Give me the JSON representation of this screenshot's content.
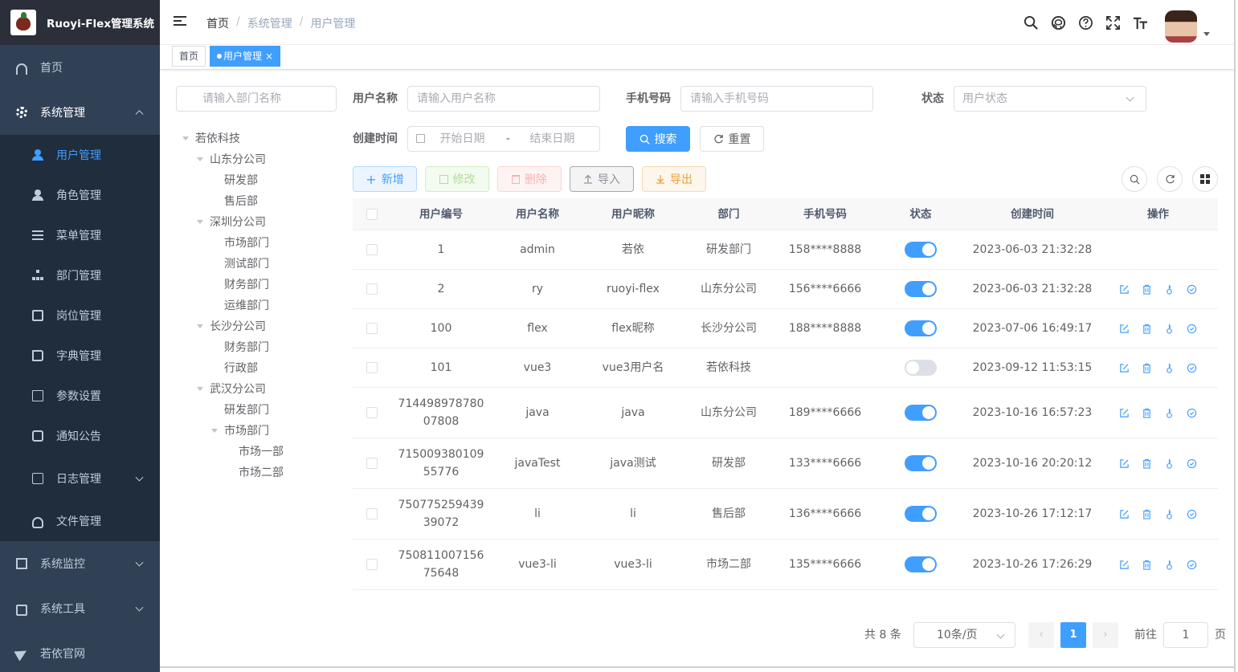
{
  "app": {
    "title": "Ruoyi-Flex管理系统"
  },
  "sidebar": {
    "home": "首页",
    "system": "系统管理",
    "sub": [
      "用户管理",
      "角色管理",
      "菜单管理",
      "部门管理",
      "岗位管理",
      "字典管理",
      "参数设置",
      "通知公告",
      "日志管理",
      "文件管理"
    ],
    "monitor": "系统监控",
    "tools": "系统工具",
    "site": "若依官网"
  },
  "breadcrumb": [
    "首页",
    "系统管理",
    "用户管理"
  ],
  "tags": {
    "home": "首页",
    "active": "用户管理"
  },
  "search": {
    "dept_placeholder": "请输入部门名称",
    "username_label": "用户名称",
    "username_placeholder": "请输入用户名称",
    "phone_label": "手机号码",
    "phone_placeholder": "请输入手机号码",
    "status_label": "状态",
    "status_placeholder": "用户状态",
    "created_label": "创建时间",
    "start_placeholder": "开始日期",
    "range_sep": "-",
    "end_placeholder": "结束日期",
    "search_btn": "搜索",
    "reset_btn": "重置"
  },
  "toolbar": {
    "add": "新增",
    "edit": "修改",
    "delete": "删除",
    "import": "导入",
    "export": "导出"
  },
  "tree": [
    {
      "label": "若依科技",
      "level": 0,
      "caret": true
    },
    {
      "label": "山东分公司",
      "level": 1,
      "caret": true
    },
    {
      "label": "研发部",
      "level": 2,
      "caret": false
    },
    {
      "label": "售后部",
      "level": 2,
      "caret": false
    },
    {
      "label": "深圳分公司",
      "level": 1,
      "caret": true
    },
    {
      "label": "市场部门",
      "level": 2,
      "caret": false
    },
    {
      "label": "测试部门",
      "level": 2,
      "caret": false
    },
    {
      "label": "财务部门",
      "level": 2,
      "caret": false
    },
    {
      "label": "运维部门",
      "level": 2,
      "caret": false
    },
    {
      "label": "长沙分公司",
      "level": 1,
      "caret": true
    },
    {
      "label": "财务部门",
      "level": 2,
      "caret": false
    },
    {
      "label": "行政部",
      "level": 2,
      "caret": false
    },
    {
      "label": "武汉分公司",
      "level": 1,
      "caret": true
    },
    {
      "label": "研发部门",
      "level": 2,
      "caret": false
    },
    {
      "label": "市场部门",
      "level": 2,
      "caret": true
    },
    {
      "label": "市场一部",
      "level": 3,
      "caret": false
    },
    {
      "label": "市场二部",
      "level": 3,
      "caret": false
    }
  ],
  "table": {
    "headers": [
      "用户编号",
      "用户名称",
      "用户昵称",
      "部门",
      "手机号码",
      "状态",
      "创建时间",
      "操作"
    ],
    "rows": [
      {
        "id": "1",
        "name": "admin",
        "nick": "若依",
        "dept": "研发部门",
        "phone": "158****8888",
        "enabled": true,
        "time": "2023-06-03 21:32:28",
        "ops": false
      },
      {
        "id": "2",
        "name": "ry",
        "nick": "ruoyi-flex",
        "dept": "山东分公司",
        "phone": "156****6666",
        "enabled": true,
        "time": "2023-06-03 21:32:28",
        "ops": true
      },
      {
        "id": "100",
        "name": "flex",
        "nick": "flex昵称",
        "dept": "长沙分公司",
        "phone": "188****8888",
        "enabled": true,
        "time": "2023-07-06 16:49:17",
        "ops": true
      },
      {
        "id": "101",
        "name": "vue3",
        "nick": "vue3用户名",
        "dept": "若依科技",
        "phone": "",
        "enabled": false,
        "time": "2023-09-12 11:53:15",
        "ops": true
      },
      {
        "id": "714498978780 07808",
        "id1": "714498978780",
        "id2": "07808",
        "name": "java",
        "nick": "java",
        "dept": "山东分公司",
        "phone": "189****6666",
        "enabled": true,
        "time": "2023-10-16 16:57:23",
        "ops": true
      },
      {
        "id": "715009380109 55776",
        "id1": "715009380109",
        "id2": "55776",
        "name": "javaTest",
        "nick": "java测试",
        "dept": "研发部",
        "phone": "133****6666",
        "enabled": true,
        "time": "2023-10-16 20:20:12",
        "ops": true
      },
      {
        "id": "750775259439 39072",
        "id1": "750775259439",
        "id2": "39072",
        "name": "li",
        "nick": "li",
        "dept": "售后部",
        "phone": "136****6666",
        "enabled": true,
        "time": "2023-10-26 17:12:17",
        "ops": true
      },
      {
        "id": "750811007156 75648",
        "id1": "750811007156",
        "id2": "75648",
        "name": "vue3-li",
        "nick": "vue3-li",
        "dept": "市场二部",
        "phone": "135****6666",
        "enabled": true,
        "time": "2023-10-26 17:26:29",
        "ops": true
      }
    ]
  },
  "pagination": {
    "total": "共 8 条",
    "page_size": "10条/页",
    "current": "1",
    "goto_label": "前往",
    "goto_value": "1",
    "page_suffix": "页"
  },
  "colors": {
    "primary": "#409eff",
    "sidebar": "#304156",
    "sidebar_sub": "#1f2d3d"
  }
}
